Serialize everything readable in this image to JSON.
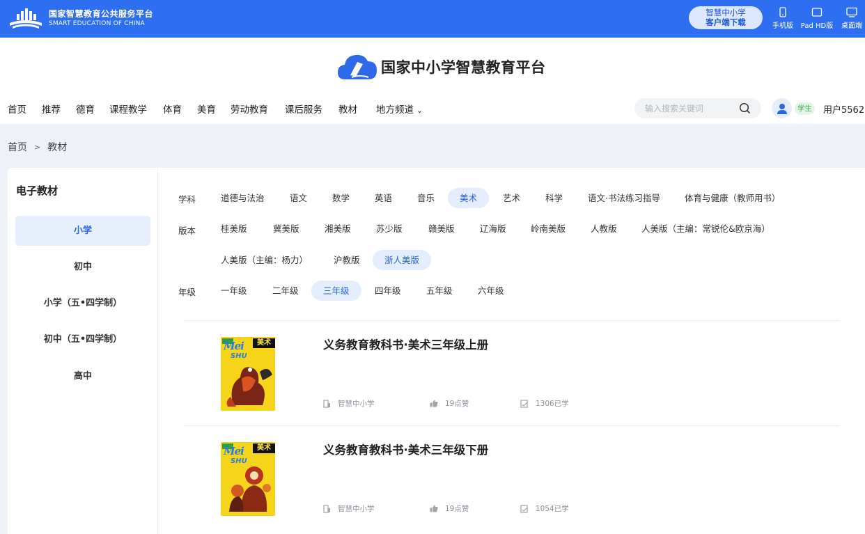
{
  "topbar": {
    "brand_cn": "国家智慧教育公共服务平台",
    "brand_en": "SMART EDUCATION OF CHINA",
    "download_line1": "智慧中小学",
    "download_line2": "客户端下载",
    "devices": [
      {
        "label": "手机版",
        "icon": "phone-icon"
      },
      {
        "label": "Pad HD版",
        "icon": "tablet-icon"
      },
      {
        "label": "桌面端",
        "icon": "desktop-icon"
      }
    ],
    "color": "#2d6ff0"
  },
  "header": {
    "site_title": "国家中小学智慧教育平台",
    "nav": [
      "首页",
      "推荐",
      "德育",
      "课程教学",
      "体育",
      "美育",
      "劳动教育",
      "课后服务",
      "教材",
      "地方频道"
    ],
    "search_placeholder": "输入搜索关键词",
    "role": "学生",
    "username": "用户5562"
  },
  "breadcrumb": [
    "首页",
    "教材"
  ],
  "sidebar": {
    "title": "电子教材",
    "items": [
      "小学",
      "初中",
      "小学（五•四学制）",
      "初中（五•四学制）",
      "高中"
    ],
    "active_index": 0
  },
  "filters": {
    "subject_label": "学科",
    "subjects": [
      "道德与法治",
      "语文",
      "数学",
      "英语",
      "音乐",
      "美术",
      "艺术",
      "科学",
      "语文·书法练习指导",
      "体育与健康（教师用书）"
    ],
    "subject_active": "美术",
    "edition_label": "版本",
    "editions": [
      "桂美版",
      "冀美版",
      "湘美版",
      "苏少版",
      "赣美版",
      "辽海版",
      "岭南美版",
      "人教版",
      "人美版（主编：常锐伦&欧京海）",
      "人美版（主编：杨力）",
      "沪教版",
      "浙人美版"
    ],
    "edition_active": "浙人美版",
    "grade_label": "年级",
    "grades": [
      "一年级",
      "二年级",
      "三年级",
      "四年级",
      "五年级",
      "六年级"
    ],
    "grade_active": "三年级"
  },
  "books": [
    {
      "title": "义务教育教科书·美术三年级上册",
      "source": "智慧中小学",
      "likes": "19点赞",
      "learners": "1306已学",
      "cover_tag": "美术",
      "cover_mei": "Mei",
      "cover_shu": "SHU"
    },
    {
      "title": "义务教育教科书·美术三年级下册",
      "source": "智慧中小学",
      "likes": "19点赞",
      "learners": "1054已学",
      "cover_tag": "美术",
      "cover_mei": "Mei",
      "cover_shu": "SHU"
    }
  ],
  "accent_color": "#2b65e8"
}
